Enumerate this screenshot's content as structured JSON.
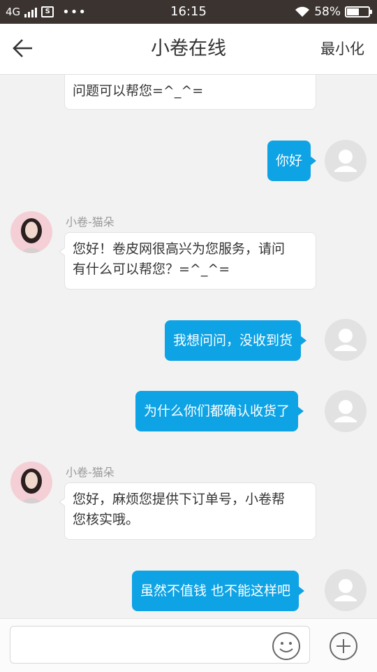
{
  "status_bar": {
    "network": "4G",
    "time": "16:15",
    "battery": "58%",
    "battery_level": 0.58,
    "more": "•••"
  },
  "header": {
    "title": "小卷在线",
    "minimize_label": "最小化"
  },
  "messages": [
    {
      "from": "agent",
      "text": "问题可以帮您=^_^="
    },
    {
      "from": "user",
      "text": "你好"
    },
    {
      "from": "agent",
      "sender": "小卷-猫朵",
      "lines": [
        "您好！卷皮网很高兴为您服务，请问",
        "有什么可以帮您？=^_^="
      ]
    },
    {
      "from": "user",
      "text": "我想问问，没收到货"
    },
    {
      "from": "user",
      "text": "为什么你们都确认收货了"
    },
    {
      "from": "agent",
      "sender": "小卷-猫朵",
      "lines": [
        "您好，麻烦您提供下订单号，小卷帮",
        "您核实哦。"
      ]
    },
    {
      "from": "user",
      "text": "虽然不值钱 也不能这样吧"
    }
  ],
  "input": {
    "value": "",
    "emoji_icon": "smiley-icon",
    "more_icon": "plus-circle-icon"
  },
  "colors": {
    "status_bar": "#3a3330",
    "user_bubble": "#0ea3e5",
    "agent_bubble": "#ffffff",
    "background": "#f2f2f2"
  }
}
